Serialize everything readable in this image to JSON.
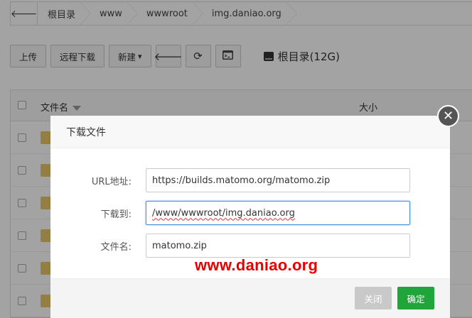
{
  "breadcrumb": {
    "back_icon": "arrow-left-icon",
    "items": [
      "根目录",
      "www",
      "wwwroot",
      "img.daniao.org"
    ]
  },
  "toolbar": {
    "upload": "上传",
    "remote_download": "远程下载",
    "new": "新建",
    "new_caret": "▾",
    "back_icon": "arrow-left-icon",
    "refresh_icon": "refresh-icon",
    "terminal_icon": "terminal-icon",
    "disk_label": "根目录(12G)"
  },
  "table": {
    "col_name": "文件名",
    "col_size": "大小",
    "rows": [
      {},
      {},
      {},
      {},
      {},
      {}
    ]
  },
  "dialog": {
    "title": "下载文件",
    "close_icon": "close-icon",
    "fields": {
      "url_label": "URL地址:",
      "url_value": "https://builds.matomo.org/matomo.zip",
      "dest_label": "下载到:",
      "dest_value": "/www/wwwroot/img.daniao.org",
      "filename_label": "文件名:",
      "filename_value": "matomo.zip"
    },
    "watermark": "www.daniao.org",
    "buttons": {
      "close": "关闭",
      "ok": "确定"
    }
  },
  "colors": {
    "primary_green": "#20a53a",
    "watermark_red": "#e60000",
    "folder": "#e8c66a"
  }
}
